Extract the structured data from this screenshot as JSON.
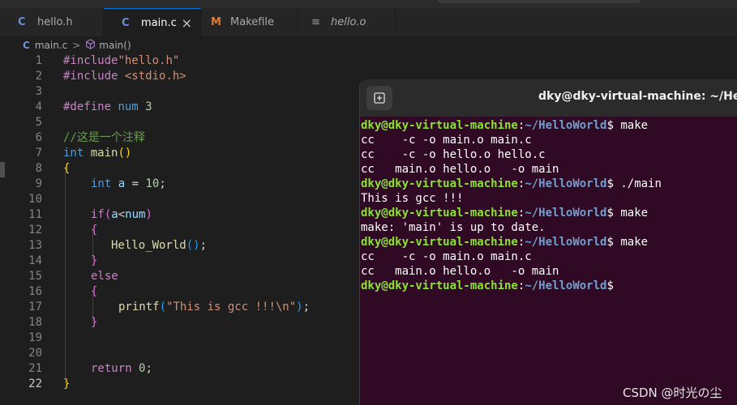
{
  "tabs": [
    {
      "icon": "C",
      "label": "hello.h"
    },
    {
      "icon": "C",
      "label": "main.c",
      "close": "×"
    },
    {
      "icon": "M",
      "label": "Makefile"
    },
    {
      "icon": "≡",
      "label": "hello.o"
    }
  ],
  "breadcrumb": {
    "icon": "C",
    "file": "main.c",
    "sep": ">",
    "symbol": "main()"
  },
  "editor": {
    "line_numbers": [
      "1",
      "2",
      "3",
      "4",
      "5",
      "6",
      "7",
      "8",
      "9",
      "10",
      "11",
      "12",
      "13",
      "14",
      "15",
      "16",
      "17",
      "18",
      "19",
      "20",
      "21",
      "22"
    ],
    "current_line": "22",
    "code": {
      "l1_a": "#include",
      "l1_b": "\"hello.h\"",
      "l2_a": "#include",
      "l2_b": " <stdio.h>",
      "l4_a": "#define",
      "l4_b": " num",
      "l4_c": " 3",
      "l6": "//这是一个注释",
      "l7_a": "int",
      "l7_b": " main",
      "l7_c": "()",
      "l8": "{",
      "l9_a": "int",
      "l9_b": " a",
      "l9_c": " = ",
      "l9_d": "10",
      "l9_e": ";",
      "l11_a": "if",
      "l11_b": "(",
      "l11_c": "a",
      "l11_d": "<",
      "l11_e": "num",
      "l11_f": ")",
      "l12": "{",
      "l13_a": "Hello_World",
      "l13_b": "()",
      "l13_c": ";",
      "l14": "}",
      "l15": "else",
      "l16": "{",
      "l17_a": "printf",
      "l17_b": "(",
      "l17_c": "\"This is gcc !!!\\n\"",
      "l17_d": ")",
      "l17_e": ";",
      "l18": "}",
      "l21_a": "return",
      "l21_b": " 0",
      "l21_c": ";",
      "l22": "}"
    }
  },
  "terminal": {
    "title": "dky@dky-virtual-machine: ~/HelloWorld",
    "new_tab_icon": "+",
    "user": "dky@dky-virtual-machine",
    "colon": ":",
    "path": "~/HelloWorld",
    "prompt": "$",
    "lines": [
      {
        "type": "prompt",
        "cmd": " make"
      },
      {
        "type": "out",
        "text": "cc    -c -o main.o main.c"
      },
      {
        "type": "out",
        "text": "cc    -c -o hello.o hello.c"
      },
      {
        "type": "out",
        "text": "cc   main.o hello.o   -o main"
      },
      {
        "type": "prompt",
        "cmd": " ./main"
      },
      {
        "type": "out",
        "text": "This is gcc !!!"
      },
      {
        "type": "prompt",
        "cmd": " make"
      },
      {
        "type": "out",
        "text": "make: 'main' is up to date."
      },
      {
        "type": "prompt",
        "cmd": " make"
      },
      {
        "type": "out",
        "text": "cc    -c -o main.o main.c"
      },
      {
        "type": "out",
        "text": "cc   main.o hello.o   -o main"
      },
      {
        "type": "prompt",
        "cmd": ""
      }
    ]
  },
  "watermark": "CSDN @时光の尘",
  "colors": {
    "accent": "#0078d4",
    "terminal_bg": "#300a24",
    "term_user": "#8ae234",
    "term_path": "#729fcf"
  }
}
